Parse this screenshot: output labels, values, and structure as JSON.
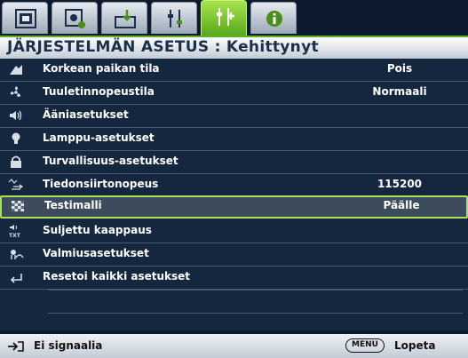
{
  "tabs": [
    {
      "icon": "picture-icon"
    },
    {
      "icon": "picture-advanced-icon"
    },
    {
      "icon": "display-setup-icon"
    },
    {
      "icon": "system-setup-basic-icon"
    },
    {
      "icon": "system-setup-advanced-icon",
      "active": true
    },
    {
      "icon": "information-icon"
    }
  ],
  "title": "JÄRJESTELMÄN ASETUS : Kehittynyt",
  "menu": {
    "items": [
      {
        "icon": "high-altitude-icon",
        "label": "Korkean paikan tila",
        "value": "Pois"
      },
      {
        "icon": "fan-icon",
        "label": "Tuuletinnopeustila",
        "value": "Normaali"
      },
      {
        "icon": "speaker-icon",
        "label": "Ääniasetukset",
        "value": ""
      },
      {
        "icon": "lamp-icon",
        "label": "Lamppu-asetukset",
        "value": ""
      },
      {
        "icon": "lock-icon",
        "label": "Turvallisuus-asetukset",
        "value": ""
      },
      {
        "icon": "baud-rate-icon",
        "label": "Tiedonsiirtonopeus",
        "value": "115200"
      },
      {
        "icon": "test-pattern-icon",
        "label": "Testimalli",
        "value": "Päälle",
        "selected": true
      },
      {
        "icon": "closed-caption-icon",
        "label": "Suljettu kaappaus",
        "value": ""
      },
      {
        "icon": "standby-icon",
        "label": "Valmiusasetukset",
        "value": ""
      },
      {
        "icon": "reset-icon",
        "label": "Resetoi kaikki asetukset",
        "value": ""
      }
    ]
  },
  "footer": {
    "source_icon": "input-source-icon",
    "source_text": "Ei signaalia",
    "menu_key": "MENU",
    "exit_text": "Lopeta"
  },
  "colors": {
    "active_tab": "#7cc93a",
    "selection_border": "#a8e25a",
    "menu_background": "#14273f"
  }
}
